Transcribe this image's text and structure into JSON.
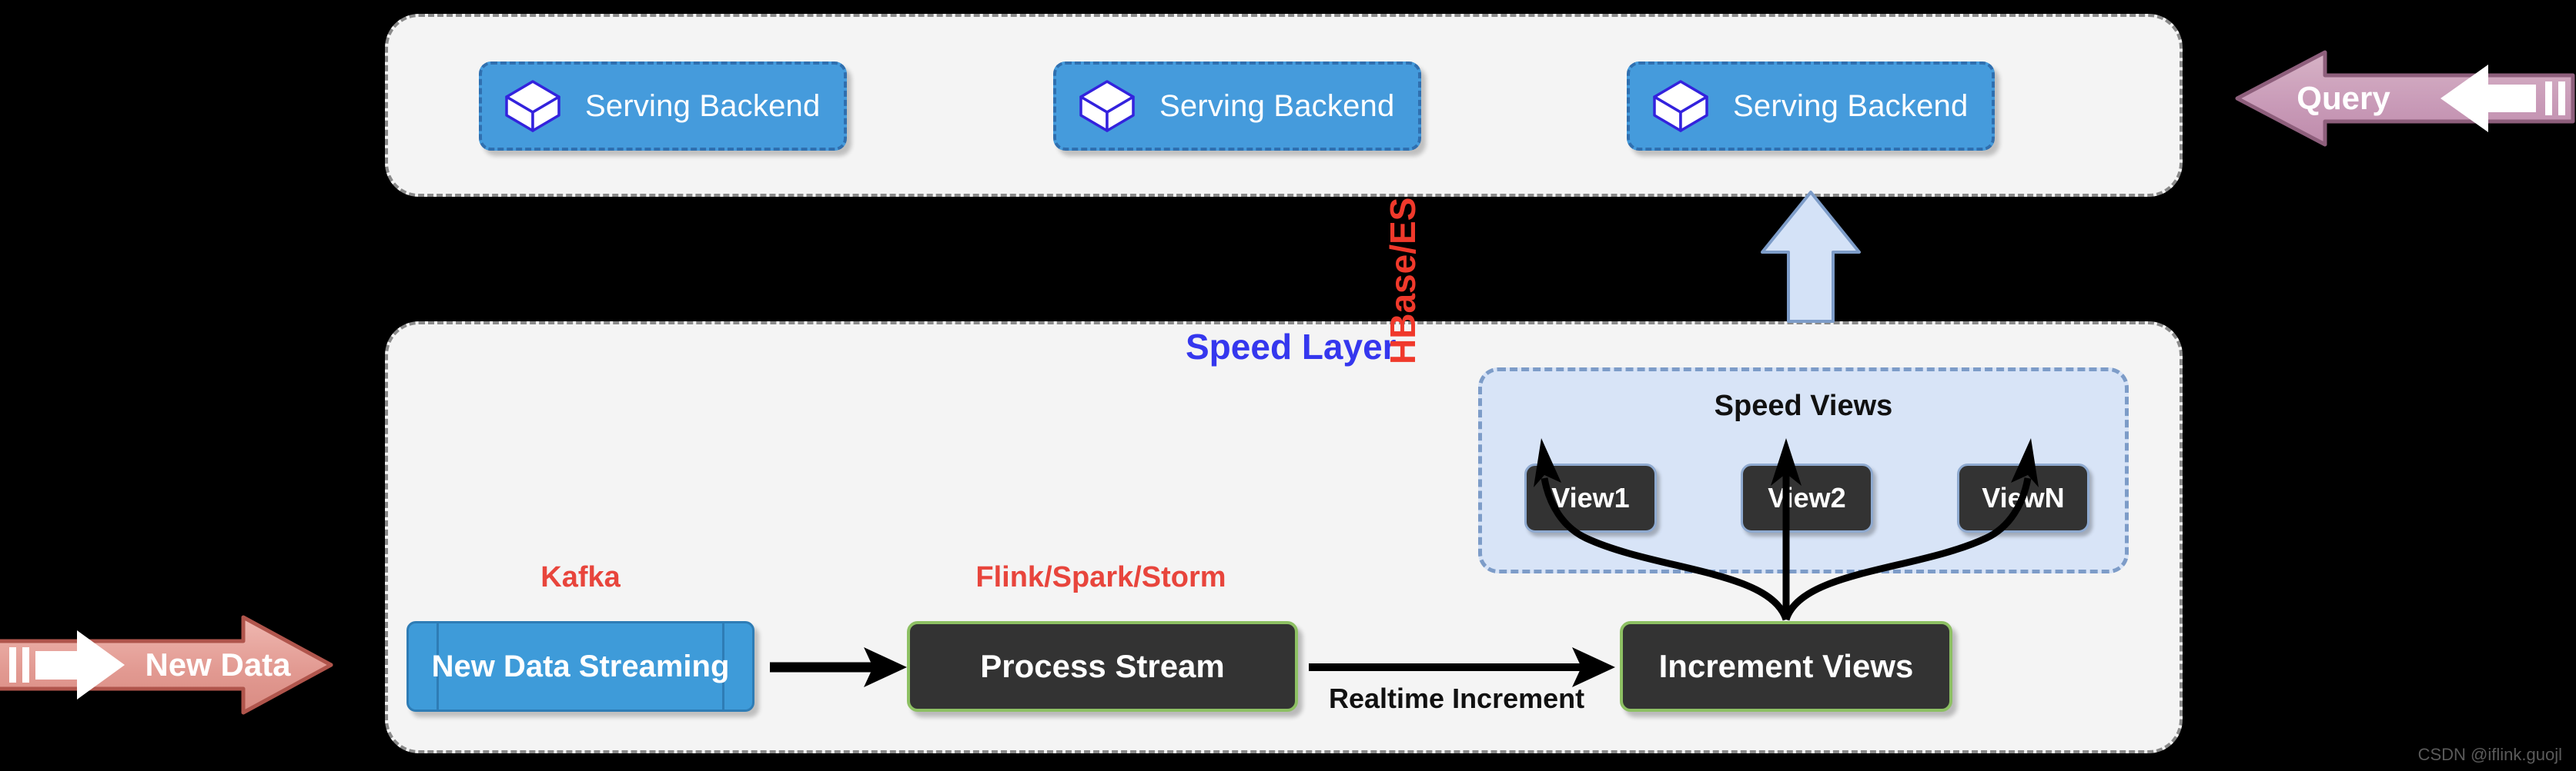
{
  "serving_layer": {
    "backends": [
      {
        "label": "Serving Backend",
        "icon": "cube-icon"
      },
      {
        "label": "Serving Backend",
        "icon": "cube-icon"
      },
      {
        "label": "Serving Backend",
        "icon": "cube-icon"
      }
    ]
  },
  "query_arrow": {
    "label": "Query",
    "direction": "left",
    "color": "#C99BB8"
  },
  "new_data_arrow": {
    "label": "New Data",
    "direction": "right",
    "color": "#E29A92"
  },
  "speed_layer": {
    "title": "Speed Layer",
    "title_color": "#3537EE",
    "storage_label": "HBase/ES",
    "storage_label_color": "#F0392B",
    "speed_views": {
      "title": "Speed Views",
      "views": [
        {
          "label": "View1"
        },
        {
          "label": "View2"
        },
        {
          "label": "ViewN"
        }
      ]
    },
    "pipeline": {
      "kafka_label": "Kafka",
      "kafka_label_color": "#E8453C",
      "streaming_box": "New Data Streaming",
      "engine_label": "Flink/Spark/Storm",
      "engine_label_color": "#E8453C",
      "process_box": "Process Stream",
      "edge_label": "Realtime Increment",
      "increment_box": "Increment Views"
    }
  },
  "watermark": "CSDN @iflink.guojl"
}
